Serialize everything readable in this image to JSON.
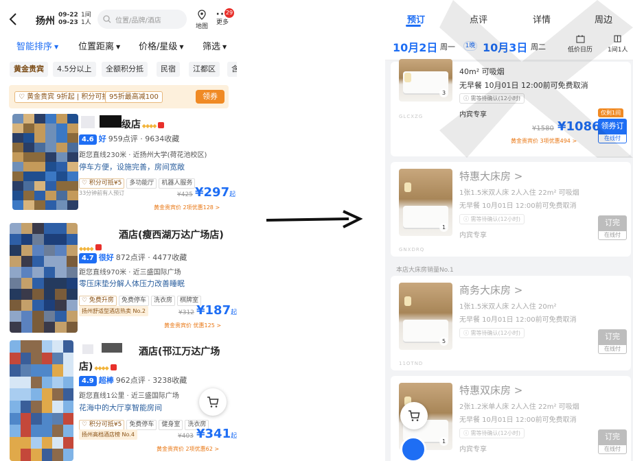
{
  "left": {
    "header": {
      "city": "扬州",
      "checkin": "09-22",
      "checkout": "09-23",
      "nights": "1间",
      "guests": "1人",
      "search_placeholder": "位置/品牌/酒店",
      "map_label": "地图",
      "more_label": "更多",
      "more_badge": "29"
    },
    "sort": [
      "智能排序",
      "位置距离",
      "价格/星级",
      "筛选"
    ],
    "filters": [
      "黄金贵宾",
      "4.5分以上",
      "全额积分抵",
      "民宿",
      "江都区",
      "含"
    ],
    "gold_bar": {
      "tag": "♡ 黄金贵宾 9折起 | 积分可抵¥5",
      "tag2": "95折最高减100",
      "button": "领券"
    },
    "hotels": [
      {
        "name_suffix": "级店",
        "score": "4.6",
        "score_word": "好",
        "reviews": "959点评 · 9634收藏",
        "location": "距您直线230米 · 近扬州大学(荷花池校区)",
        "highlight": "停车方便，设施完善，房间宽敞",
        "tags": [
          "♡ 积分可抵¥5",
          "多功能厅",
          "机器人服务"
        ],
        "note": "33分钟前有人预订",
        "price_old": "¥425",
        "price_now": "¥297",
        "price_suffix": "起",
        "gold_price": "黄金贵宾价  2项优惠128 >"
      },
      {
        "name_suffix": "酒店(瘦西湖万达广场店)",
        "score": "4.7",
        "score_word": "很好",
        "reviews": "872点评 · 4477收藏",
        "location": "距您直线970米 · 近三盛国际广场",
        "highlight": "零压床垫分解人体压力改善睡眠",
        "tags": [
          "♡ 免费升房",
          "免费停车",
          "洗衣房",
          "棋牌室"
        ],
        "rank": "扬州舒适型酒店热卖 No.2",
        "price_old": "¥312",
        "price_now": "¥187",
        "price_suffix": "起",
        "gold_price": "黄金贵宾价  优惠125 >"
      },
      {
        "name_suffix": "酒店(邗江万达广场",
        "name_line2": "店)",
        "score": "4.9",
        "score_word": "超棒",
        "reviews": "962点评 · 3238收藏",
        "location": "距您直线1公里 · 近三盛国际广场",
        "highlight": "花海中的大厅享智能房间",
        "tags": [
          "♡ 积分可抵¥5",
          "免费停车",
          "健身室",
          "洗衣房"
        ],
        "rank": "扬州高档酒店榜 No.4",
        "price_old": "¥403",
        "price_now": "¥341",
        "price_suffix": "起",
        "gold_price": "黄金贵宾价  2项优惠62 >"
      }
    ]
  },
  "right": {
    "tabs": [
      "预订",
      "点评",
      "详情",
      "周边"
    ],
    "checkin": "10月2日",
    "checkin_week": "周一",
    "nights": "1晚",
    "checkout": "10月3日",
    "checkout_week": "周二",
    "calendar_label": "低价日历",
    "room_label": "1间1人",
    "rooms": [
      {
        "name": "",
        "line1": "40m²  可吸烟",
        "line2": "无早餐  10月01日 12:00前可免费取消",
        "confirm": "ⓘ 需等待确认(12小时)",
        "exclusive": "内宾专享",
        "img_count": "3",
        "img_code": "GLCXZG",
        "limit_tag": "仅剩1间",
        "price_old": "¥1580",
        "price_now": "¥1086",
        "book": "领券订",
        "pay": "在线付",
        "gold": "黄金贵宾价  3项优惠494 >"
      },
      {
        "name": "特惠大床房 >",
        "line1": "1张1.5米双人床  2人入住  22m²  可吸烟",
        "line2": "无早餐  10月01日 12:00前可免费取消",
        "confirm": "ⓘ 需等待确认(12小时)",
        "exclusive": "内宾专享",
        "img_count": "1",
        "img_code": "GNXDRQ",
        "book": "订完",
        "pay": "在线付"
      },
      {
        "section": "本店大床房销量No.1",
        "name": "商务大床房 >",
        "line1": "1张1.5米双人床  2人入住  20m²",
        "line2": "无早餐  10月01日 12:00前可免费取消",
        "confirm": "ⓘ 需等待确认(12小时)",
        "img_count": "5",
        "img_code": "11OTND",
        "book": "订完",
        "pay": "在线付"
      },
      {
        "name": "特惠双床房 >",
        "line1": "2张1.2米单人床  2人入住  22m²  可吸烟",
        "line2": "无早餐  10月01日 12:00前可免费取消",
        "confirm": "ⓘ 需等待确认(12小时)",
        "exclusive": "内宾专享",
        "img_count": "1",
        "book": "订完",
        "pay": "在线付"
      }
    ]
  },
  "colors": {
    "brand_blue": "#1e6ef4",
    "gold_text": "#8a5215",
    "orange": "#f08a24",
    "soldout_gray": "#bdbdbd"
  }
}
